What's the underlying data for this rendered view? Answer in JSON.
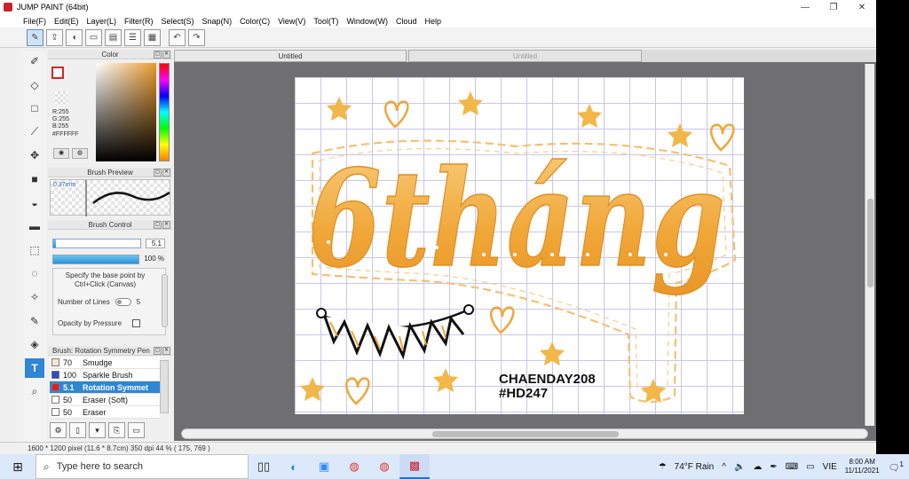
{
  "app": {
    "title": "JUMP PAINT (64bit)"
  },
  "window_controls": {
    "minimize": "—",
    "restore": "❐",
    "close": "✕"
  },
  "menu": [
    "File(F)",
    "Edit(E)",
    "Layer(L)",
    "Filter(R)",
    "Select(S)",
    "Snap(N)",
    "Color(C)",
    "View(V)",
    "Tool(T)",
    "Window(W)",
    "Cloud",
    "Help"
  ],
  "toolbar_icons": [
    "pen-cursor-icon",
    "layer-upload-icon",
    "speech-bubble-icon",
    "comment-icon",
    "page-icon",
    "page-list-icon",
    "page-grid-icon",
    "undo-icon",
    "redo-icon"
  ],
  "tools": [
    "brush-icon",
    "eraser-icon",
    "selection-rect-icon",
    "line-tool-icon",
    "move-icon",
    "fill-rect-icon",
    "bucket-icon",
    "gradient-icon",
    "select-dotted-icon",
    "lasso-icon",
    "magic-wand-icon",
    "select-pen-icon",
    "select-eraser-icon",
    "text-icon",
    "dropper-icon"
  ],
  "color_panel": {
    "title": "Color",
    "rgb_lines": [
      "R:255",
      "G:255",
      "B:255"
    ],
    "hex": "#FFFFFF",
    "main_color": "#ffffff",
    "border_color": "#d8252b"
  },
  "brush_preview": {
    "title": "Brush Preview",
    "size": "0.37mm"
  },
  "brush_control": {
    "title": "Brush Control",
    "size_value": "5.1",
    "size_fill": 0.03,
    "opacity_value": "100 %",
    "opacity_fill": 1.0,
    "description": "Specify the base point by Ctrl+Click (Canvas)",
    "lines_label": "Number of Lines",
    "lines_value": "5",
    "pressure_label": "Opacity by Pressure"
  },
  "brush_list": {
    "title": "Brush: Rotation Symmetry Pen",
    "items": [
      {
        "size": "70",
        "name": "Smudge",
        "swatch": "#f7e6d6"
      },
      {
        "size": "100",
        "name": "Sparkle Brush",
        "swatch": "#2b4ec7"
      },
      {
        "size": "5.1",
        "name": "Rotation Symmet",
        "swatch": "#e02020",
        "selected": true
      },
      {
        "size": "50",
        "name": "Eraser (Soft)",
        "swatch": "#ffffff"
      },
      {
        "size": "50",
        "name": "Eraser",
        "swatch": "#ffffff"
      }
    ]
  },
  "tabs": {
    "active": "Untitled",
    "inactive": "Untitled"
  },
  "artwork": {
    "title_text": "6tháng",
    "signature_line1": "CHAENDAY208",
    "signature_line2": "#HD247",
    "accent": "#f0a637",
    "star_color": "#f3b648"
  },
  "status": {
    "text": "1600 * 1200 pixel  (11.6 * 8.7cm)  350 dpi  44 %  ( 175, 769 )"
  },
  "taskbar": {
    "search_placeholder": "Type here to search",
    "weather": "74°F  Rain",
    "lang": "VIE",
    "time": "8:00 AM",
    "date": "11/11/2021",
    "notifications": "1"
  }
}
